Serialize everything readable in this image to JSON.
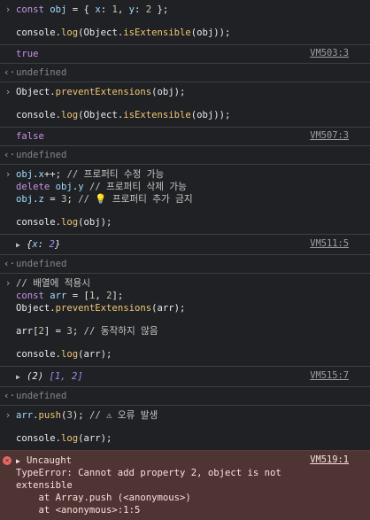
{
  "entries": [
    {
      "input": [
        "const obj = { x: 1, y: 2 };",
        "",
        "console.log(Object.isExtensible(obj));"
      ],
      "output": "true",
      "source": "VM503:3",
      "result": "undefined"
    },
    {
      "input": [
        "Object.preventExtensions(obj);",
        "",
        "console.log(Object.isExtensible(obj));"
      ],
      "output": "false",
      "source": "VM507:3",
      "result": "undefined"
    },
    {
      "input": [
        "obj.x++; // 프로퍼티 수정 가능",
        "delete obj.y // 프로퍼티 삭제 가능",
        "obj.z = 3; // 💡 프로퍼티 추가 금지",
        "",
        "console.log(obj);"
      ],
      "output": "{x: 2}",
      "output_key": "x",
      "output_val": "2",
      "source": "VM511:5",
      "result": "undefined"
    },
    {
      "input": [
        "// 배열에 적용시",
        "const arr = [1, 2];",
        "Object.preventExtensions(arr);",
        "",
        "arr[2] = 3; // 동작하지 않음",
        "",
        "console.log(arr);"
      ],
      "output_len": "(2)",
      "output_arr": "[1, 2]",
      "source": "VM515:7",
      "result": "undefined"
    },
    {
      "input": [
        "arr.push(3); // ⚠ 오류 발생",
        "",
        "console.log(arr);"
      ]
    }
  ],
  "error": {
    "label": "Uncaught",
    "message": "TypeError: Cannot add property 2, object is not\nextensible\n    at Array.push (<anonymous>)\n    at <anonymous>:1:5",
    "source": "VM519:1"
  },
  "icons": {
    "input_marker": "chevron-right-icon",
    "result_marker": "return-arrow-icon",
    "expand": "triangle-right-icon",
    "error": "error-circle-icon"
  },
  "colors": {
    "background": "#202124",
    "keyword": "#c792ea",
    "variable": "#9cdcfe",
    "number": "#b5cea8",
    "function": "#f0c674",
    "error_bg": "#4e3534"
  }
}
